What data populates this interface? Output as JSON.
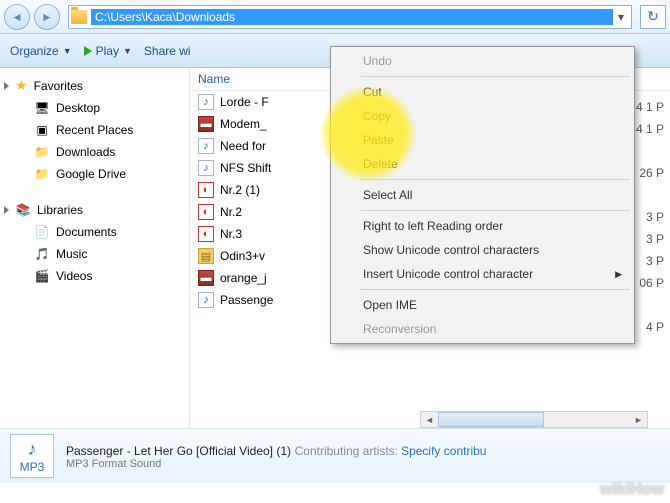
{
  "nav": {
    "path": "C:\\Users\\Kaca\\Downloads"
  },
  "toolbar": {
    "organize": "Organize",
    "play": "Play",
    "share": "Share wi"
  },
  "sidebar": {
    "favorites_label": "Favorites",
    "favs": [
      {
        "label": "Desktop",
        "icon": "🖥"
      },
      {
        "label": "Recent Places",
        "icon": "▣"
      },
      {
        "label": "Downloads",
        "icon": "📁"
      },
      {
        "label": "Google Drive",
        "icon": "📁"
      }
    ],
    "libraries_label": "Libraries",
    "libs": [
      {
        "label": "Documents",
        "icon": "📄"
      },
      {
        "label": "Music",
        "icon": "🎵"
      },
      {
        "label": "Videos",
        "icon": "🎬"
      }
    ]
  },
  "columns": {
    "name": "Name"
  },
  "files": [
    {
      "name": "Lorde - F",
      "type": "mp3"
    },
    {
      "name": "Modem_",
      "type": "rar"
    },
    {
      "name": "Need for",
      "type": "mp3"
    },
    {
      "name": "NFS Shift",
      "type": "mp3"
    },
    {
      "name": "Nr.2 (1)",
      "type": "pdf"
    },
    {
      "name": "Nr.2",
      "type": "pdf"
    },
    {
      "name": "Nr.3",
      "type": "pdf"
    },
    {
      "name": "Odin3+v",
      "type": "zip"
    },
    {
      "name": "orange_j",
      "type": "rar"
    },
    {
      "name": "Passenge",
      "type": "mp3"
    }
  ],
  "dates": [
    "",
    "",
    "4 1 P",
    "4 1 P",
    "",
    "26 P",
    "",
    "3 P",
    "3 P",
    "3 P",
    "06 P",
    "",
    "4 P"
  ],
  "menu": {
    "undo": "Undo",
    "cut": "Cut",
    "copy": "Copy",
    "paste": "Paste",
    "delete": "Delete",
    "select_all": "Select All",
    "rtl": "Right to left Reading order",
    "show_ucc": "Show Unicode control characters",
    "insert_ucc": "Insert Unicode control character",
    "open_ime": "Open IME",
    "reconversion": "Reconversion"
  },
  "details": {
    "title": "Passenger - Let Her Go [Official Video] (1)",
    "type": "MP3 Format Sound",
    "meta_label": "Contributing artists:",
    "meta_value": "Specify contribu",
    "icon_label": "MP3"
  },
  "watermark": "wikiHow"
}
